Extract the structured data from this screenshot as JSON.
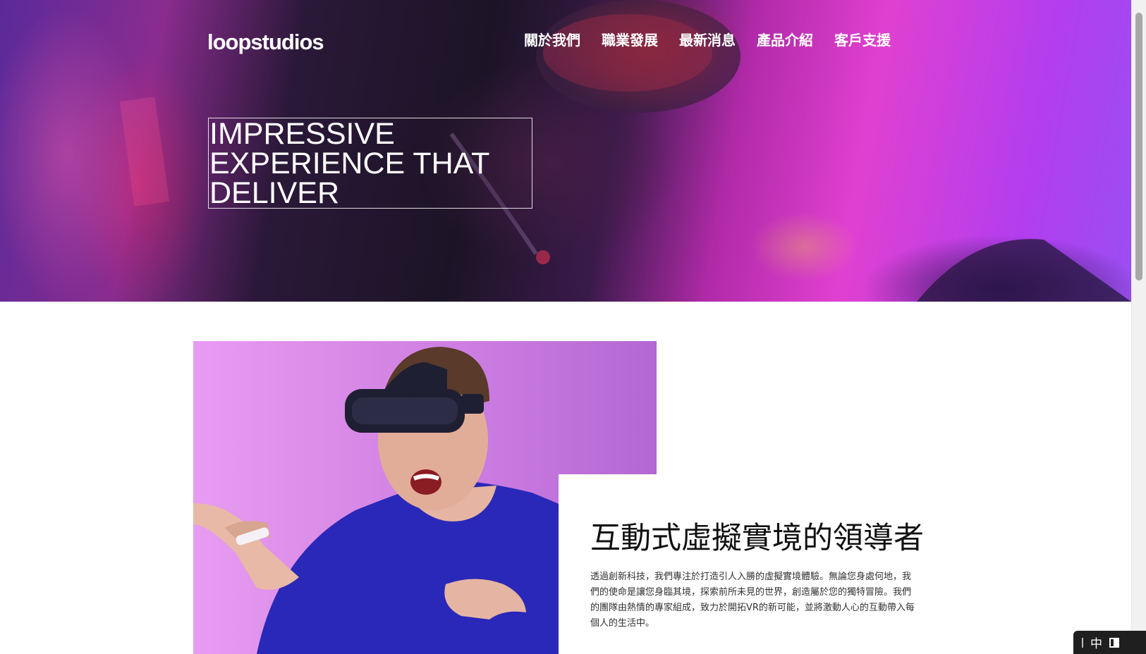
{
  "brand": {
    "logo": "loopstudios"
  },
  "nav": {
    "items": [
      {
        "label": "關於我們"
      },
      {
        "label": "職業發展"
      },
      {
        "label": "最新消息"
      },
      {
        "label": "產品介紹"
      },
      {
        "label": "客戶支援"
      }
    ]
  },
  "hero": {
    "headline": "IMPRESSIVE EXPERIENCE THAT DELIVER",
    "image_icon": "vr-headset-woman-photo"
  },
  "intro": {
    "image_icon": "vr-headset-man-photo",
    "title": "互動式虛擬實境的領導者",
    "body": "透過創新科技，我們專注於打造引人入勝的虛擬實境體驗。無論您身處何地，我們的使命是讓您身臨其境，探索前所未見的世界，創造屬於您的獨特冒險。我們的團隊由熱情的專家組成，致力於開拓VR的新可能，並將激動人心的互動帶入每個人的生活中。"
  },
  "ime": {
    "mode": "中"
  },
  "colors": {
    "hero_magenta": "#e040d0",
    "hero_purple": "#9a4ff2",
    "photo_pink": "#d889e6",
    "shirt_blue": "#2a28b8"
  }
}
